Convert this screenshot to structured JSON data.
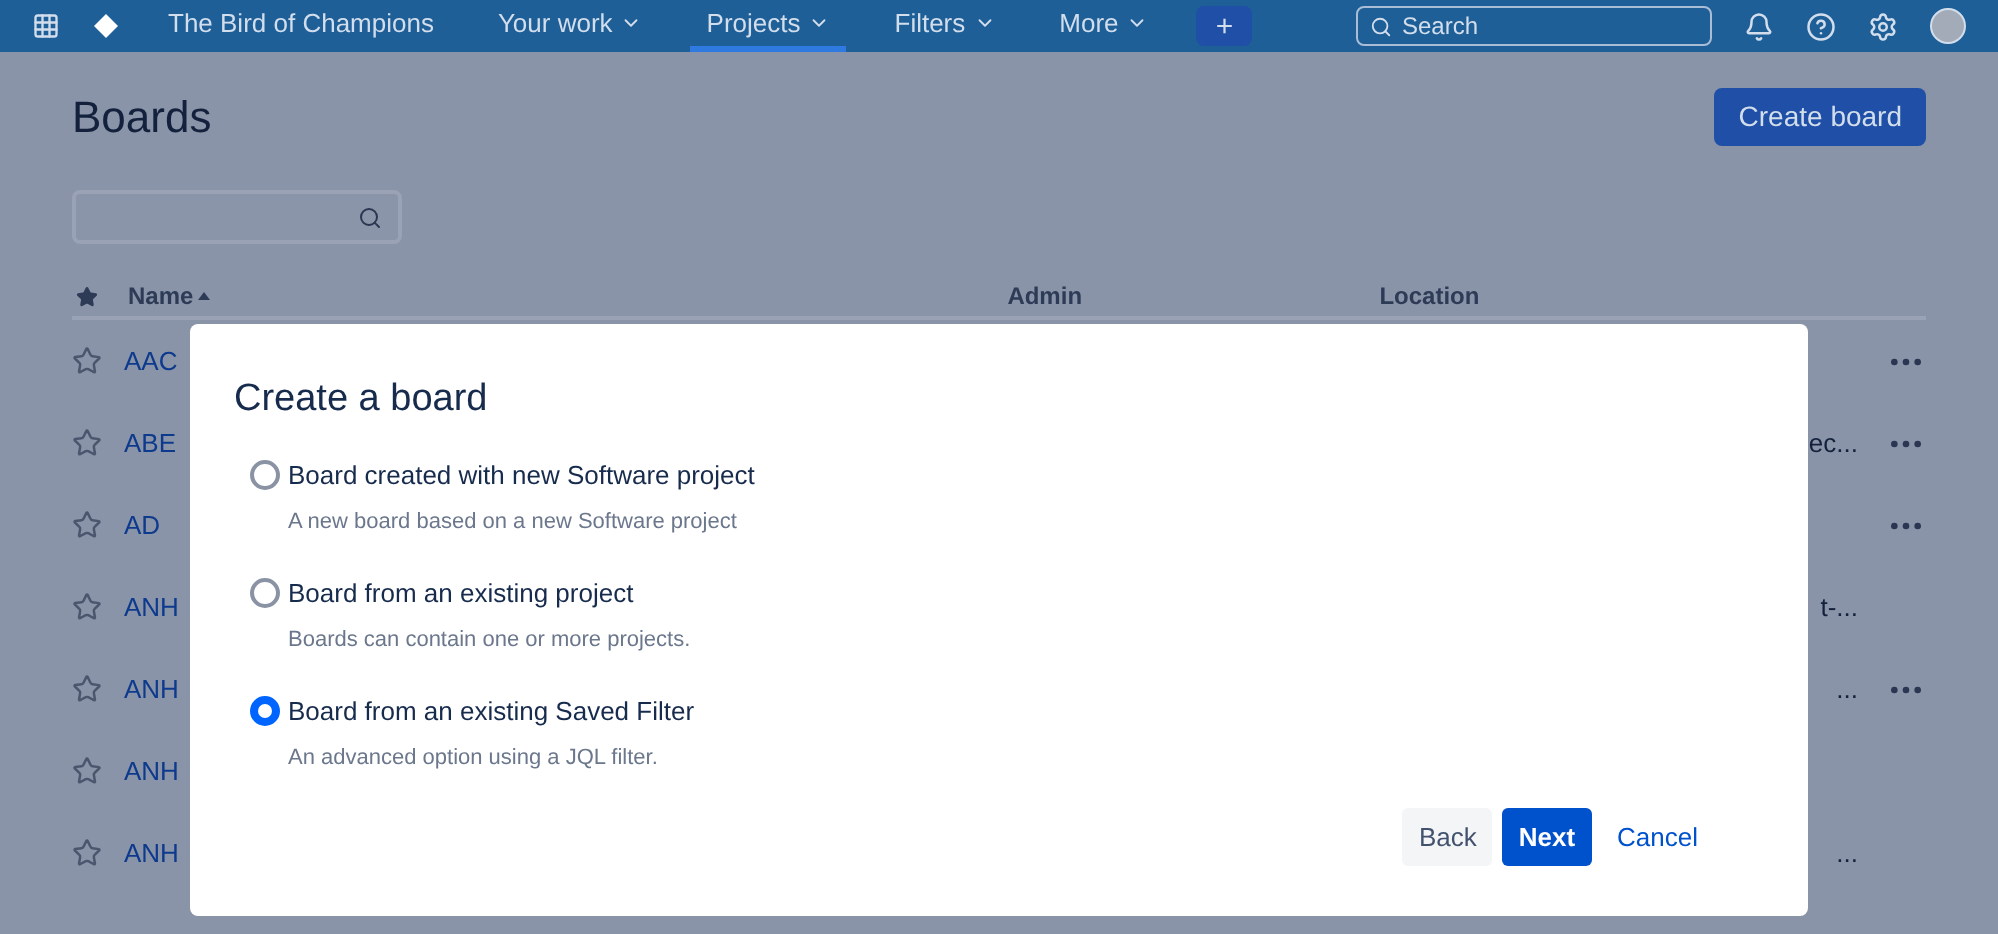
{
  "nav": {
    "items": [
      {
        "label": "The Bird of Champions",
        "selected": false,
        "dropdown": false
      },
      {
        "label": "Your work",
        "selected": false,
        "dropdown": true
      },
      {
        "label": "Projects",
        "selected": true,
        "dropdown": true
      },
      {
        "label": "Filters",
        "selected": false,
        "dropdown": true
      },
      {
        "label": "More",
        "selected": false,
        "dropdown": true
      }
    ],
    "create": "+",
    "search": {
      "placeholder": "Search"
    }
  },
  "page": {
    "title": "Boards",
    "create_button": "Create board"
  },
  "table": {
    "columns": [
      "Name",
      "Admin",
      "Location"
    ],
    "rows": [
      {
        "name": "AAC",
        "location": "",
        "menu": true
      },
      {
        "name": "ABE",
        "location": "ec...",
        "menu": true
      },
      {
        "name": "AD",
        "location": "",
        "menu": true
      },
      {
        "name": "ANH",
        "location": "t-...",
        "menu": false
      },
      {
        "name": "ANH",
        "location": "...",
        "menu": true
      },
      {
        "name": "ANH",
        "location": "",
        "menu": false
      },
      {
        "name": "ANH",
        "location": "...",
        "menu": false
      }
    ]
  },
  "dialog": {
    "title": "Create a board",
    "options": [
      {
        "label": "Board created with new Software project",
        "description": "A new board based on a new Software project",
        "selected": false
      },
      {
        "label": "Board from an existing project",
        "description": "Boards can contain one or more projects.",
        "selected": false
      },
      {
        "label": "Board from an existing Saved Filter",
        "description": "An advanced option using a JQL filter.",
        "selected": true
      }
    ],
    "buttons": [
      {
        "label": "Back",
        "kind": "secondary"
      },
      {
        "label": "Next",
        "kind": "primary"
      },
      {
        "label": "Cancel",
        "kind": "link"
      }
    ]
  }
}
